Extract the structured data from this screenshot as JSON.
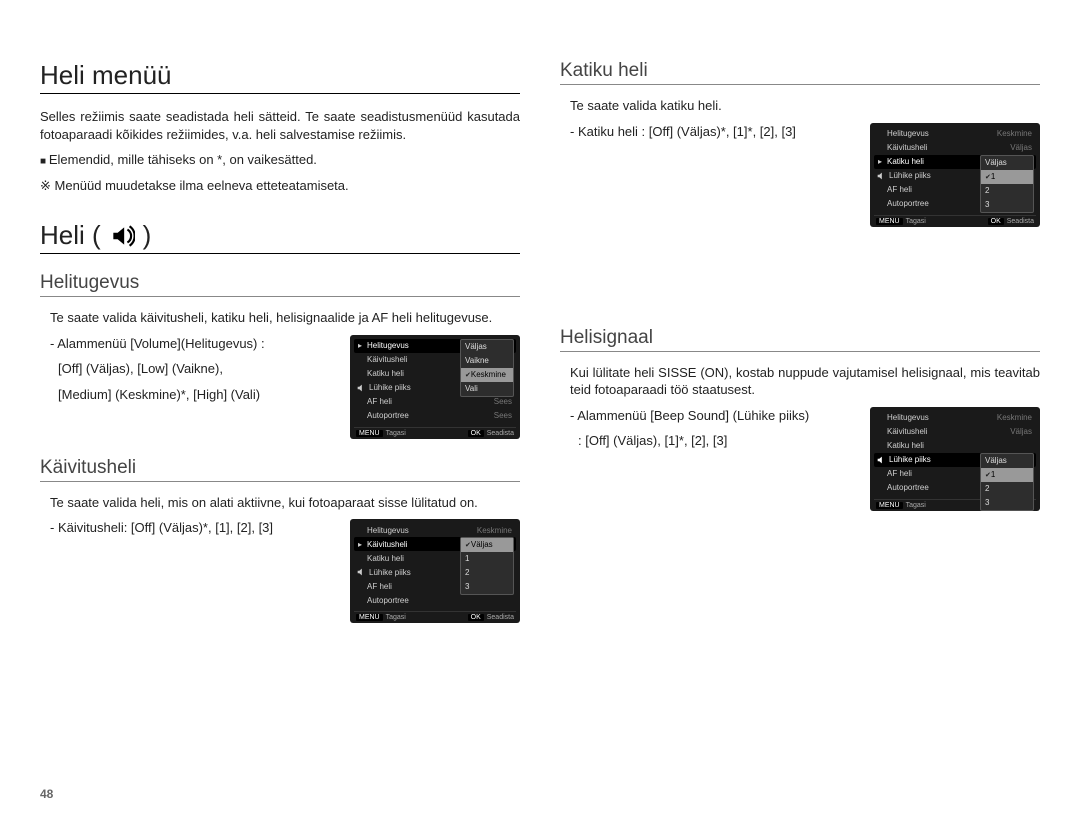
{
  "page_number": "48",
  "headings": {
    "h_heli_menu": "Heli menüü",
    "h_heli": "Heli (",
    "h_heli_close": ")",
    "sub_helitugevus": "Helitugevus",
    "sub_kaivitusheli": "Käivitusheli",
    "sub_katiku": "Katiku heli",
    "sub_helisignaal": "Helisignaal"
  },
  "intro": {
    "p1": "Selles režiimis saate seadistada heli sätteid. Te saate seadistusmenüüd kasutada fotoaparaadi kõikides režiimides, v.a. heli salvestamise režiimis.",
    "bullet1": "Elemendid, mille tähiseks on *, on vaikesätted.",
    "bullet2": "Menüüd muudetakse ilma eelneva etteteatamiseta."
  },
  "helitugevus": {
    "p1": "Te saate valida käivitusheli, katiku heli, helisignaalide ja AF heli helitugevuse.",
    "submenu_line1": "Alammenüü [Volume](Helitugevus) :",
    "submenu_line2": "[Off] (Väljas), [Low] (Vaikne),",
    "submenu_line3": "[Medium] (Keskmine)*, [High] (Vali)"
  },
  "kaivitusheli": {
    "p1": "Te saate valida heli, mis on alati aktiivne, kui fotoaparaat sisse lülitatud on.",
    "options": "Käivitusheli: [Off] (Väljas)*, [1], [2], [3]"
  },
  "katiku": {
    "p1": "Te saate valida katiku heli.",
    "options": "Katiku heli : [Off] (Väljas)*, [1]*, [2], [3]"
  },
  "helisignaal": {
    "p1": "Kui lülitate heli SISSE (ON), kostab nuppude vajutamisel helisignaal, mis teavitab teid fotoaparaadi töö staatusest.",
    "submenu_line1": "Alammenüü [Beep Sound] (Lühike piiks)",
    "submenu_line2": ": [Off] (Väljas), [1]*, [2], [3]"
  },
  "cam_menu": {
    "items": {
      "helitugevus": "Helitugevus",
      "kaivitusheli": "Käivitusheli",
      "katiku": "Katiku heli",
      "luhike": "Lühike piiks",
      "af": "AF heli",
      "autoportree": "Autoportree"
    },
    "vals": {
      "keskmine": "Keskmine",
      "valjas": "Väljas",
      "sees": "Sees",
      "vaikne": "Vaikne",
      "vali": "Vali",
      "one": "1",
      "two": "2",
      "three": "3"
    },
    "footer_back_btn": "MENU",
    "footer_back": "Tagasi",
    "footer_ok_btn": "OK",
    "footer_ok": "Seadista"
  }
}
